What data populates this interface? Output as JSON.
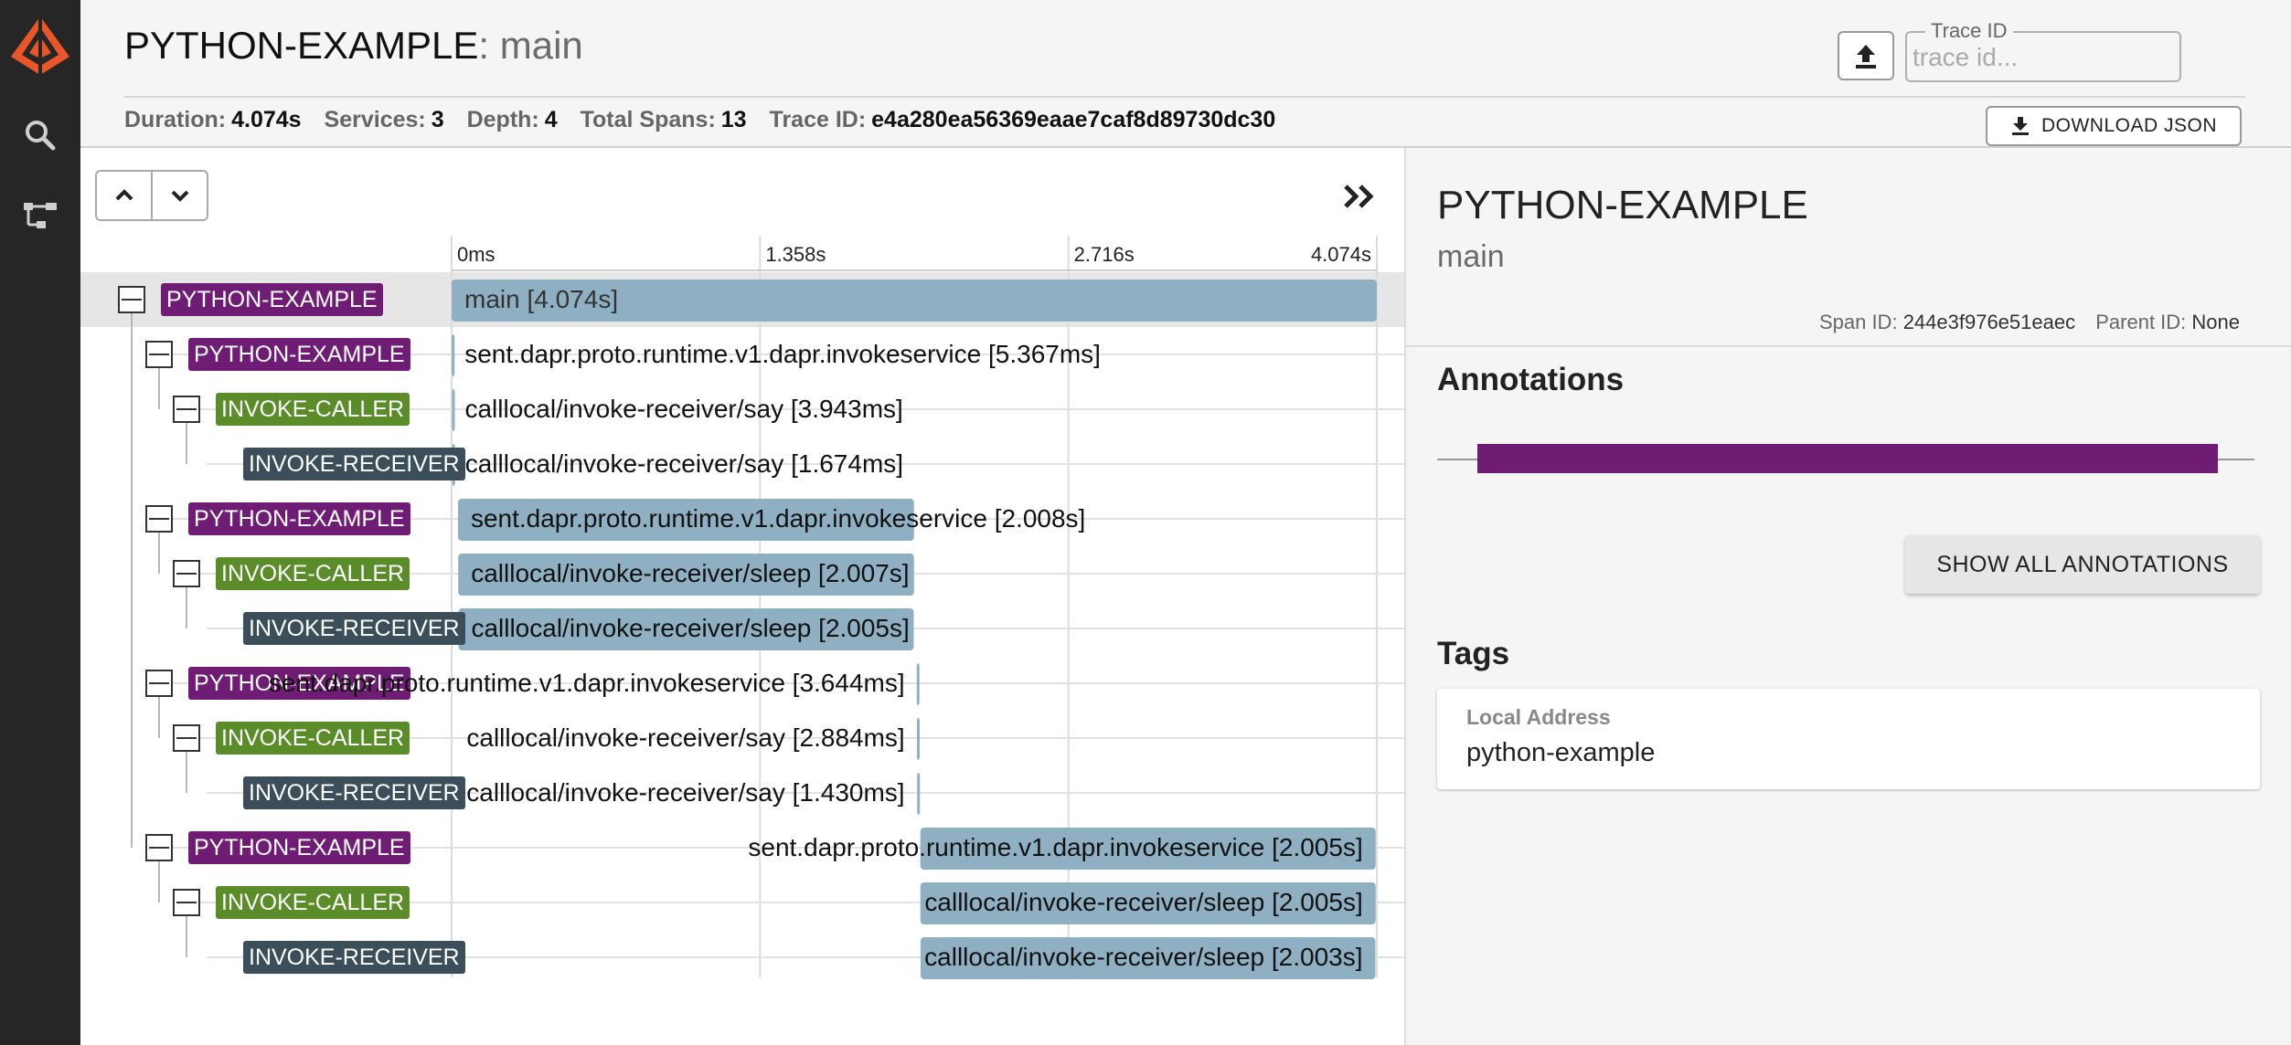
{
  "header": {
    "service": "PYTHON-EXAMPLE",
    "operation": ": main",
    "stats": [
      {
        "label": "Duration:",
        "value": "4.074s"
      },
      {
        "label": "Services:",
        "value": "3"
      },
      {
        "label": "Depth:",
        "value": "4"
      },
      {
        "label": "Total Spans:",
        "value": "13"
      },
      {
        "label": "Trace ID:",
        "value": "e4a280ea56369eaae7caf8d89730dc30"
      }
    ],
    "trace_search": {
      "legend": "Trace ID",
      "placeholder": "trace id..."
    },
    "download_label": "DOWNLOAD JSON"
  },
  "timeline": {
    "ticks": [
      "0ms",
      "1.358s",
      "2.716s",
      "4.074s"
    ],
    "total_s": 4.074,
    "rows": [
      {
        "service": "PYTHON-EXAMPLE",
        "color": "#6f1c74",
        "depth": 0,
        "span": "main [4.074s]",
        "start_s": 0.0,
        "dur_s": 4.074,
        "selected": true
      },
      {
        "service": "PYTHON-EXAMPLE",
        "color": "#6f1c74",
        "depth": 1,
        "span": "sent.dapr.proto.runtime.v1.dapr.invokeservice [5.367ms]",
        "start_s": 0.001,
        "dur_s": 0.005367
      },
      {
        "service": "INVOKE-CALLER",
        "color": "#5b8c2a",
        "depth": 2,
        "span": "calllocal/invoke-receiver/say [3.943ms]",
        "start_s": 0.002,
        "dur_s": 0.003943
      },
      {
        "service": "INVOKE-RECEIVER",
        "color": "#3c4e5a",
        "depth": 3,
        "span": "calllocal/invoke-receiver/say [1.674ms]",
        "start_s": 0.003,
        "dur_s": 0.001674
      },
      {
        "service": "PYTHON-EXAMPLE",
        "color": "#6f1c74",
        "depth": 1,
        "span": "sent.dapr.proto.runtime.v1.dapr.invokeservice [2.008s]",
        "start_s": 0.028,
        "dur_s": 2.008
      },
      {
        "service": "INVOKE-CALLER",
        "color": "#5b8c2a",
        "depth": 2,
        "span": "calllocal/invoke-receiver/sleep [2.007s]",
        "start_s": 0.029,
        "dur_s": 2.007
      },
      {
        "service": "INVOKE-RECEIVER",
        "color": "#3c4e5a",
        "depth": 3,
        "span": "calllocal/invoke-receiver/sleep [2.005s]",
        "start_s": 0.03,
        "dur_s": 2.005
      },
      {
        "service": "PYTHON-EXAMPLE",
        "color": "#6f1c74",
        "depth": 1,
        "span": "sent.dapr.proto.runtime.v1.dapr.invokeservice [3.644ms]",
        "start_s": 2.048,
        "dur_s": 0.003644
      },
      {
        "service": "INVOKE-CALLER",
        "color": "#5b8c2a",
        "depth": 2,
        "span": "calllocal/invoke-receiver/say [2.884ms]",
        "start_s": 2.049,
        "dur_s": 0.002884
      },
      {
        "service": "INVOKE-RECEIVER",
        "color": "#3c4e5a",
        "depth": 3,
        "span": "calllocal/invoke-receiver/say [1.430ms]",
        "start_s": 2.05,
        "dur_s": 0.00143
      },
      {
        "service": "PYTHON-EXAMPLE",
        "color": "#6f1c74",
        "depth": 1,
        "span": "sent.dapr.proto.runtime.v1.dapr.invokeservice [2.005s]",
        "start_s": 2.064,
        "dur_s": 2.005
      },
      {
        "service": "INVOKE-CALLER",
        "color": "#5b8c2a",
        "depth": 2,
        "span": "calllocal/invoke-receiver/sleep [2.005s]",
        "start_s": 2.064,
        "dur_s": 2.005
      },
      {
        "service": "INVOKE-RECEIVER",
        "color": "#3c4e5a",
        "depth": 3,
        "span": "calllocal/invoke-receiver/sleep [2.003s]",
        "start_s": 2.065,
        "dur_s": 2.003
      }
    ]
  },
  "details": {
    "service": "PYTHON-EXAMPLE",
    "operation": "main",
    "span_id_label": "Span ID:",
    "span_id": "244e3f976e51eaec",
    "parent_id_label": "Parent ID:",
    "parent_id": "None",
    "annotations_heading": "Annotations",
    "show_all_label": "SHOW ALL ANNOTATIONS",
    "tags_heading": "Tags",
    "tags": [
      {
        "key": "Local Address",
        "value": "python-example"
      }
    ]
  },
  "colors": {
    "span_bar": "#8fb0c3",
    "annotation_bar": "#6f1c74",
    "sidebar": "#262626",
    "logo": "#e8562a"
  }
}
